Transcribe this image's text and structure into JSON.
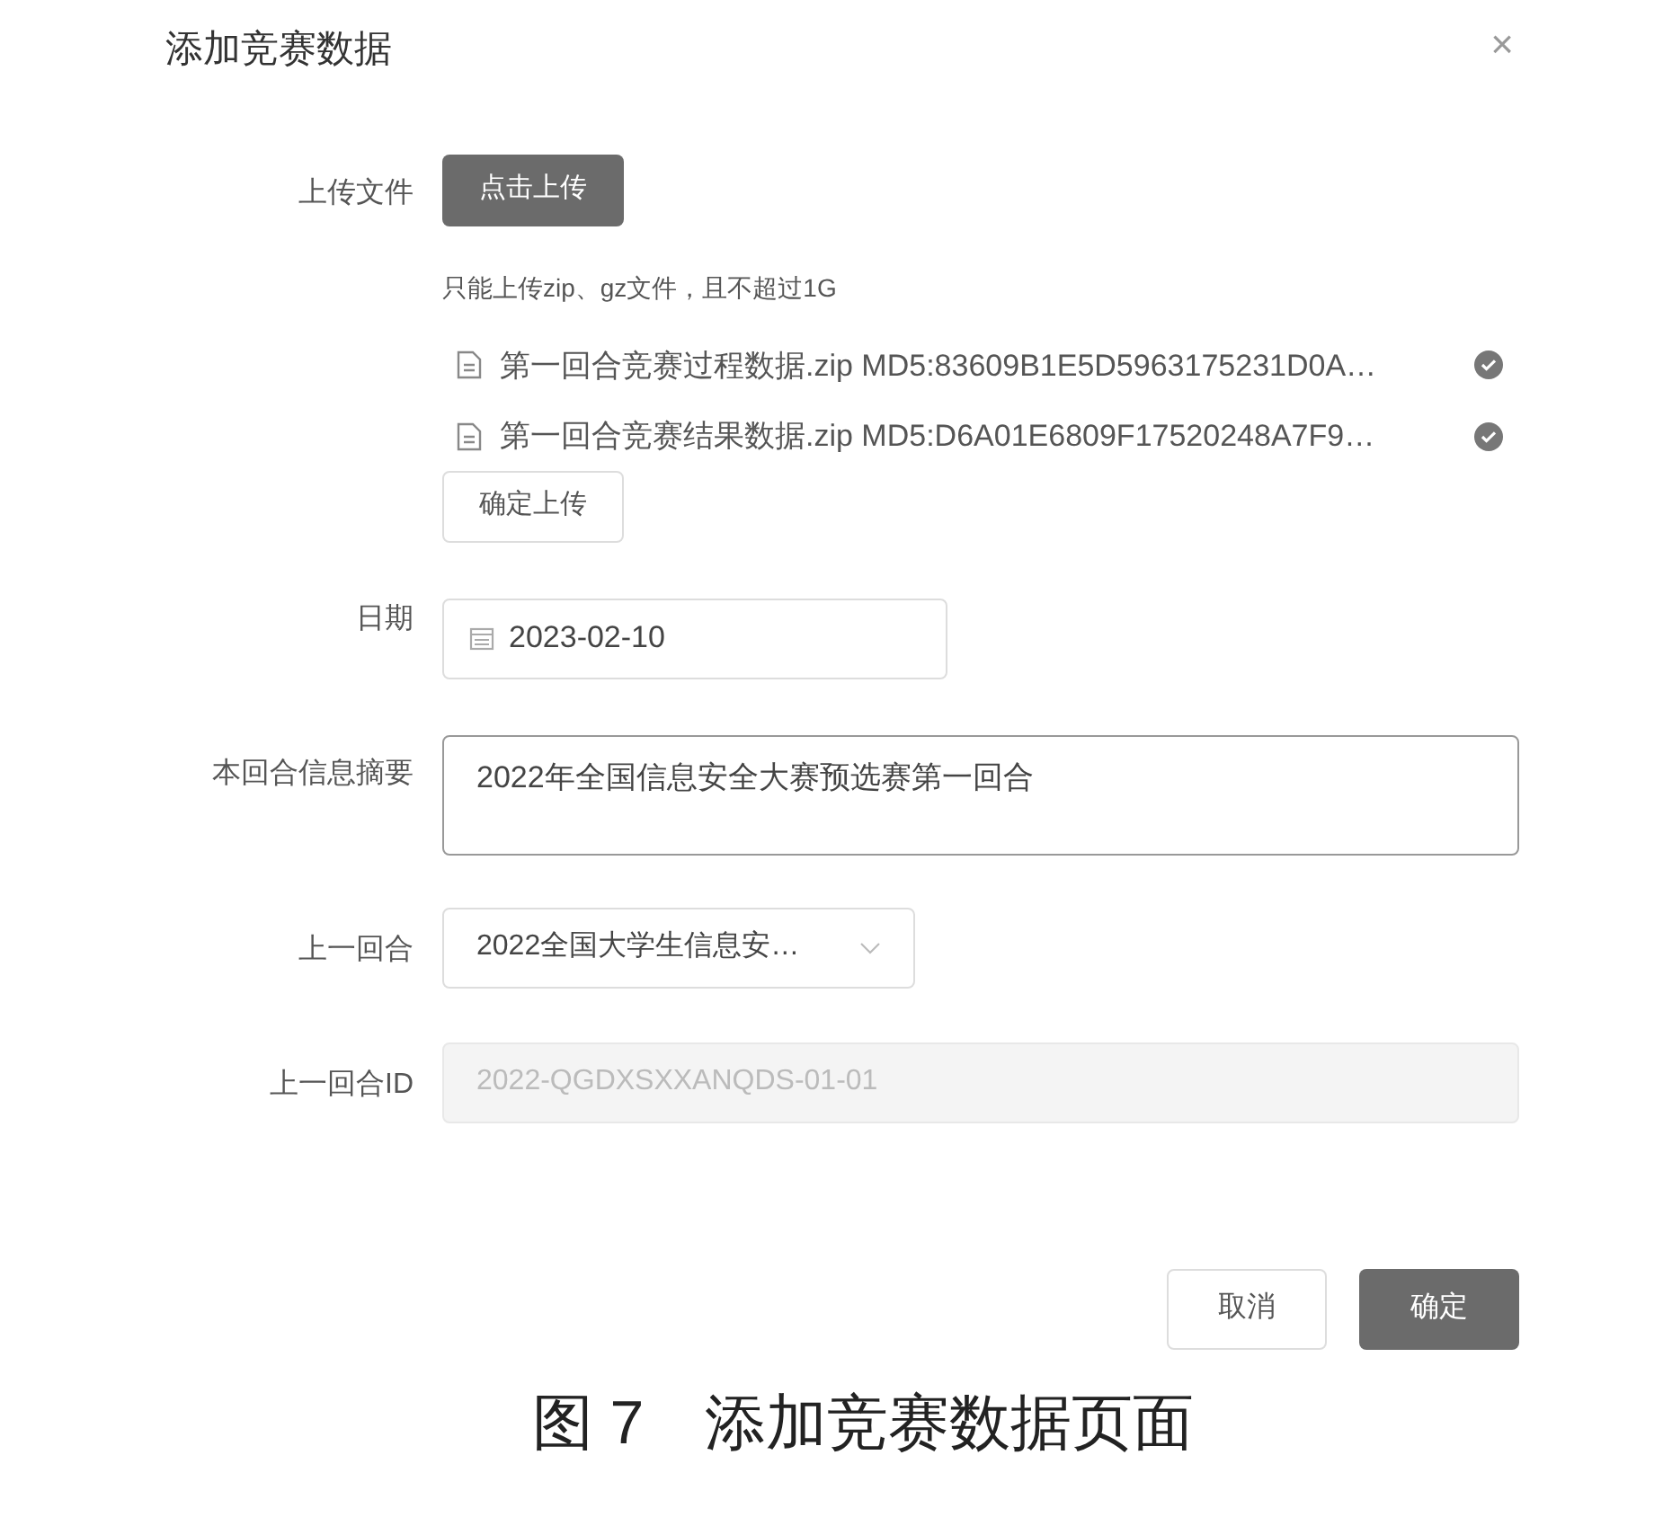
{
  "dialog": {
    "title": "添加竞赛数据",
    "close": "×"
  },
  "upload": {
    "label": "上传文件",
    "button": "点击上传",
    "hint": "只能上传zip、gz文件，且不超过1G",
    "files": [
      {
        "name": "第一回合竞赛过程数据.zip MD5:83609B1E5D5963175231D0A…",
        "done": true
      },
      {
        "name": "第一回合竞赛结果数据.zip MD5:D6A01E6809F17520248A7F9…",
        "done": true
      }
    ],
    "confirm_button": "确定上传"
  },
  "date": {
    "label": "日期",
    "value": "2023-02-10"
  },
  "summary": {
    "label": "本回合信息摘要",
    "value": "2022年全国信息安全大赛预选赛第一回合"
  },
  "previous_round": {
    "label": "上一回合",
    "value": "2022全国大学生信息安…"
  },
  "previous_round_id": {
    "label": "上一回合ID",
    "value": "2022-QGDXSXXANQDS-01-01",
    "disabled": true
  },
  "buttons": [
    {
      "label": "取消",
      "primary": false
    },
    {
      "label": "确定",
      "primary": true
    }
  ],
  "caption": "图 7　添加竞赛数据页面"
}
